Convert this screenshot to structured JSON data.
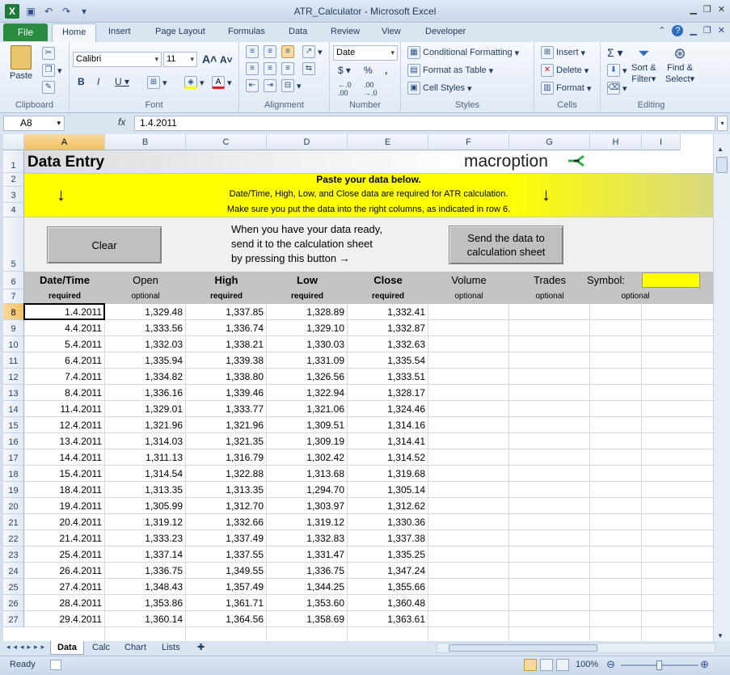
{
  "window": {
    "title": "ATR_Calculator - Microsoft Excel"
  },
  "ribbon_tabs": [
    "Home",
    "Insert",
    "Page Layout",
    "Formulas",
    "Data",
    "Review",
    "View",
    "Developer"
  ],
  "file_tab": "File",
  "ribbon": {
    "clipboard": {
      "label": "Clipboard",
      "paste": "Paste"
    },
    "font": {
      "label": "Font",
      "name": "Calibri",
      "size": "11"
    },
    "alignment": {
      "label": "Alignment"
    },
    "number": {
      "label": "Number",
      "format": "Date",
      "currency": "$",
      "percent": "%",
      "comma": ","
    },
    "styles": {
      "label": "Styles",
      "conditional": "Conditional Formatting",
      "format_table": "Format as Table",
      "cell_styles": "Cell Styles"
    },
    "cells": {
      "label": "Cells",
      "insert": "Insert",
      "delete": "Delete",
      "format": "Format"
    },
    "editing": {
      "label": "Editing",
      "sort": "Sort &",
      "filter": "Filter",
      "find": "Find &",
      "select": "Select"
    }
  },
  "formula_bar": {
    "name_box": "A8",
    "fx": "fx",
    "value": "1.4.2011"
  },
  "columns": [
    "A",
    "B",
    "C",
    "D",
    "E",
    "F",
    "G",
    "H",
    "I"
  ],
  "sheet": {
    "title": "Data Entry",
    "logo": "macroption",
    "banner": {
      "line1": "Paste your data below.",
      "line2": "Date/Time, High, Low, and Close data are required for ATR calculation.",
      "line3": "Make sure you put the data into the right columns, as indicated in row 6.",
      "arrow": "↓"
    },
    "clear_button": "Clear",
    "instructions": [
      "When you have your data ready,",
      "send it to the calculation sheet",
      "by pressing this button  →"
    ],
    "send_button": "Send the data to calculation sheet",
    "headers": [
      "Date/Time",
      "Open",
      "High",
      "Low",
      "Close",
      "Volume",
      "Trades",
      "Symbol:"
    ],
    "subheaders": [
      "required",
      "optional",
      "required",
      "required",
      "required",
      "optional",
      "optional",
      "optional"
    ],
    "rows": [
      [
        "1.4.2011",
        "1,329.48",
        "1,337.85",
        "1,328.89",
        "1,332.41"
      ],
      [
        "4.4.2011",
        "1,333.56",
        "1,336.74",
        "1,329.10",
        "1,332.87"
      ],
      [
        "5.4.2011",
        "1,332.03",
        "1,338.21",
        "1,330.03",
        "1,332.63"
      ],
      [
        "6.4.2011",
        "1,335.94",
        "1,339.38",
        "1,331.09",
        "1,335.54"
      ],
      [
        "7.4.2011",
        "1,334.82",
        "1,338.80",
        "1,326.56",
        "1,333.51"
      ],
      [
        "8.4.2011",
        "1,336.16",
        "1,339.46",
        "1,322.94",
        "1,328.17"
      ],
      [
        "11.4.2011",
        "1,329.01",
        "1,333.77",
        "1,321.06",
        "1,324.46"
      ],
      [
        "12.4.2011",
        "1,321.96",
        "1,321.96",
        "1,309.51",
        "1,314.16"
      ],
      [
        "13.4.2011",
        "1,314.03",
        "1,321.35",
        "1,309.19",
        "1,314.41"
      ],
      [
        "14.4.2011",
        "1,311.13",
        "1,316.79",
        "1,302.42",
        "1,314.52"
      ],
      [
        "15.4.2011",
        "1,314.54",
        "1,322.88",
        "1,313.68",
        "1,319.68"
      ],
      [
        "18.4.2011",
        "1,313.35",
        "1,313.35",
        "1,294.70",
        "1,305.14"
      ],
      [
        "19.4.2011",
        "1,305.99",
        "1,312.70",
        "1,303.97",
        "1,312.62"
      ],
      [
        "20.4.2011",
        "1,319.12",
        "1,332.66",
        "1,319.12",
        "1,330.36"
      ],
      [
        "21.4.2011",
        "1,333.23",
        "1,337.49",
        "1,332.83",
        "1,337.38"
      ],
      [
        "25.4.2011",
        "1,337.14",
        "1,337.55",
        "1,331.47",
        "1,335.25"
      ],
      [
        "26.4.2011",
        "1,336.75",
        "1,349.55",
        "1,336.75",
        "1,347.24"
      ],
      [
        "27.4.2011",
        "1,348.43",
        "1,357.49",
        "1,344.25",
        "1,355.66"
      ],
      [
        "28.4.2011",
        "1,353.86",
        "1,361.71",
        "1,353.60",
        "1,360.48"
      ],
      [
        "29.4.2011",
        "1,360.14",
        "1,364.56",
        "1,358.69",
        "1,363.61"
      ]
    ]
  },
  "row_numbers": [
    "1",
    "2",
    "3",
    "4",
    "5",
    "6",
    "7",
    "8",
    "9",
    "10",
    "11",
    "12",
    "13",
    "14",
    "15",
    "16",
    "17",
    "18",
    "19",
    "20",
    "21",
    "22",
    "23",
    "24",
    "25",
    "26",
    "27"
  ],
  "sheet_tabs": [
    "Data",
    "Calc",
    "Chart",
    "Lists"
  ],
  "status": {
    "ready": "Ready",
    "zoom": "100%"
  },
  "colors": {
    "banner": "#ffff00",
    "file_tab": "#2a8c3f",
    "logo_accent": "#2bb14a"
  }
}
